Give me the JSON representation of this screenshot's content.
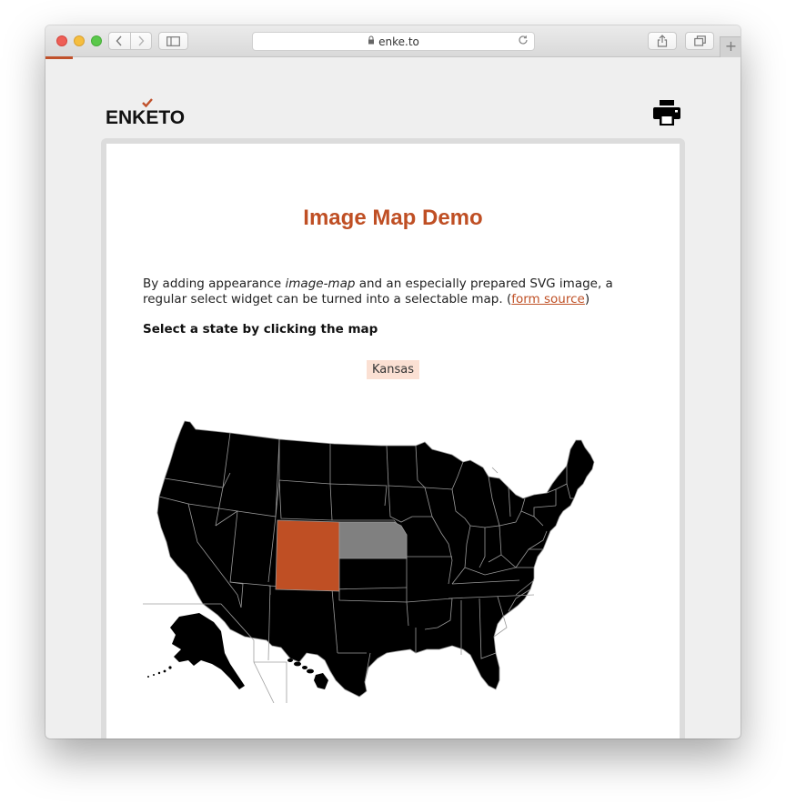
{
  "browser": {
    "url": "enke.to",
    "new_tab_symbol": "+"
  },
  "header": {
    "logo_text": "ENKETO",
    "print_icon": "printer-icon"
  },
  "form": {
    "title": "Image Map Demo",
    "intro_before_em": "By adding appearance ",
    "intro_em": "image-map",
    "intro_after_em": " and an especially prepared SVG image, a regular select widget can be turned into a selectable map. (",
    "intro_link": "form source",
    "intro_end": ")",
    "question_label": "Select a state by clicking the map",
    "selected_value": "Kansas"
  },
  "colors": {
    "accent": "#bf4f24",
    "highlight_state": "#bf4f24",
    "hover_state": "#808080",
    "map_fill": "#000000",
    "selected_bg": "#fbe0d3"
  }
}
